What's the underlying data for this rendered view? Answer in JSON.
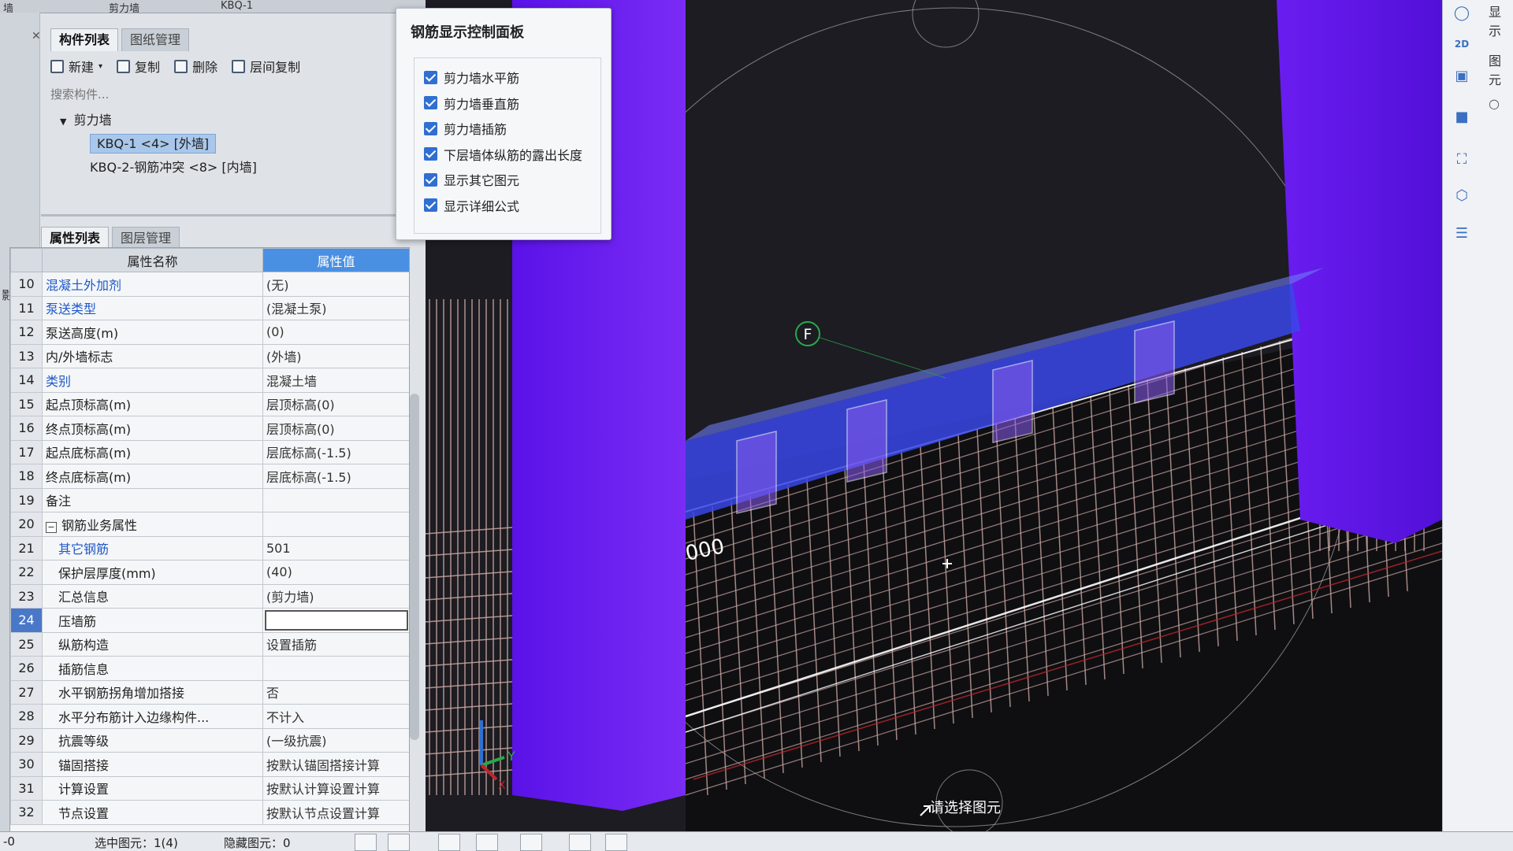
{
  "top_strip": {
    "a": "墙",
    "b": "剪力墙",
    "c": "KBQ-1"
  },
  "gutter_char": "影.",
  "component_tabs": [
    "构件列表",
    "图纸管理"
  ],
  "toolbar": {
    "new": "新建",
    "copy": "复制",
    "delete": "删除",
    "floor_copy": "层间复制"
  },
  "search": {
    "placeholder": "搜索构件..."
  },
  "tree": {
    "group": "剪力墙",
    "items": [
      "KBQ-1 <4> [外墙]",
      "KBQ-2-钢筋冲突 <8> [内墙]"
    ]
  },
  "property_tabs": [
    "属性列表",
    "图层管理"
  ],
  "table": {
    "col_name": "属性名称",
    "col_value": "属性值",
    "rows": [
      {
        "num": "10",
        "name": "混凝土外加剂",
        "value": "(无)"
      },
      {
        "num": "11",
        "name": "泵送类型",
        "value": "(混凝土泵)"
      },
      {
        "num": "12",
        "name": "泵送高度(m)",
        "value": "(0)"
      },
      {
        "num": "13",
        "name": "内/外墙标志",
        "value": "(外墙)"
      },
      {
        "num": "14",
        "name": "类别",
        "value": "混凝土墙"
      },
      {
        "num": "15",
        "name": "起点顶标高(m)",
        "value": "层顶标高(0)"
      },
      {
        "num": "16",
        "name": "终点顶标高(m)",
        "value": "层顶标高(0)"
      },
      {
        "num": "17",
        "name": "起点底标高(m)",
        "value": "层底标高(-1.5)"
      },
      {
        "num": "18",
        "name": "终点底标高(m)",
        "value": "层底标高(-1.5)"
      },
      {
        "num": "19",
        "name": "备注",
        "value": ""
      },
      {
        "num": "20",
        "name": "钢筋业务属性",
        "value": "",
        "expand": "−"
      },
      {
        "num": "21",
        "name": "其它钢筋",
        "value": "501"
      },
      {
        "num": "22",
        "name": "保护层厚度(mm)",
        "value": "(40)"
      },
      {
        "num": "23",
        "name": "汇总信息",
        "value": "(剪力墙)"
      },
      {
        "num": "24",
        "name": "压墙筋",
        "value": ""
      },
      {
        "num": "25",
        "name": "纵筋构造",
        "value": "设置插筋"
      },
      {
        "num": "26",
        "name": "插筋信息",
        "value": ""
      },
      {
        "num": "27",
        "name": "水平钢筋拐角增加搭接",
        "value": "否"
      },
      {
        "num": "28",
        "name": "水平分布筋计入边缘构件...",
        "value": "不计入"
      },
      {
        "num": "29",
        "name": "抗震等级",
        "value": "(一级抗震)"
      },
      {
        "num": "30",
        "name": "锚固搭接",
        "value": "按默认锚固搭接计算"
      },
      {
        "num": "31",
        "name": "计算设置",
        "value": "按默认计算设置计算"
      },
      {
        "num": "32",
        "name": "节点设置",
        "value": "按默认节点设置计算"
      }
    ]
  },
  "control_panel": {
    "title": "钢筋显示控制面板",
    "options": [
      "剪力墙水平筋",
      "剪力墙垂直筋",
      "剪力墙插筋",
      "下层墙体纵筋的露出长度",
      "显示其它图元",
      "显示详细公式"
    ]
  },
  "viewport": {
    "axis_label": "F",
    "dimension_text": "000",
    "axis_y": "Y",
    "axis_x": "X",
    "prompt": "请选择图元"
  },
  "right_toolbar": {
    "label": "显示",
    "label2": "图元",
    "mode_2d": "2D"
  },
  "statusbar": {
    "left": "-0",
    "selected": "选中图元：1(4)",
    "hidden": "隐藏图元：0"
  },
  "colors": {
    "wall_purple": "#6a1df0",
    "rebar": "#c9a6a0",
    "accent": "#4a90e2",
    "checkbox": "#2f6fd1"
  }
}
